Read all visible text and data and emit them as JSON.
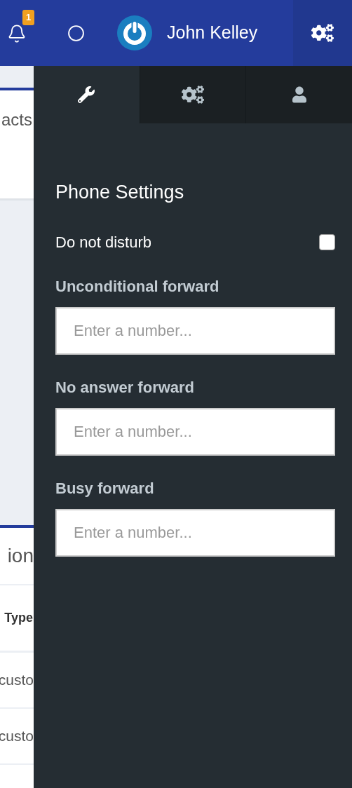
{
  "header": {
    "notification_count": "1",
    "user_name": "John Kelley"
  },
  "background_page": {
    "card_title": "acts",
    "section_title": "ion",
    "column_header": "Type",
    "rows": [
      "custo",
      "custo"
    ]
  },
  "settings_panel": {
    "tabs": [
      {
        "kind": "wrench",
        "selected": true
      },
      {
        "kind": "cogs",
        "selected": false
      },
      {
        "kind": "user",
        "selected": false
      }
    ],
    "title": "Phone Settings",
    "do_not_disturb": {
      "label": "Do not disturb",
      "checked": false
    },
    "fields": [
      {
        "label": "Unconditional forward",
        "placeholder": "Enter a number..."
      },
      {
        "label": "No answer forward",
        "placeholder": "Enter a number..."
      },
      {
        "label": "Busy forward",
        "placeholder": "Enter a number..."
      }
    ]
  }
}
